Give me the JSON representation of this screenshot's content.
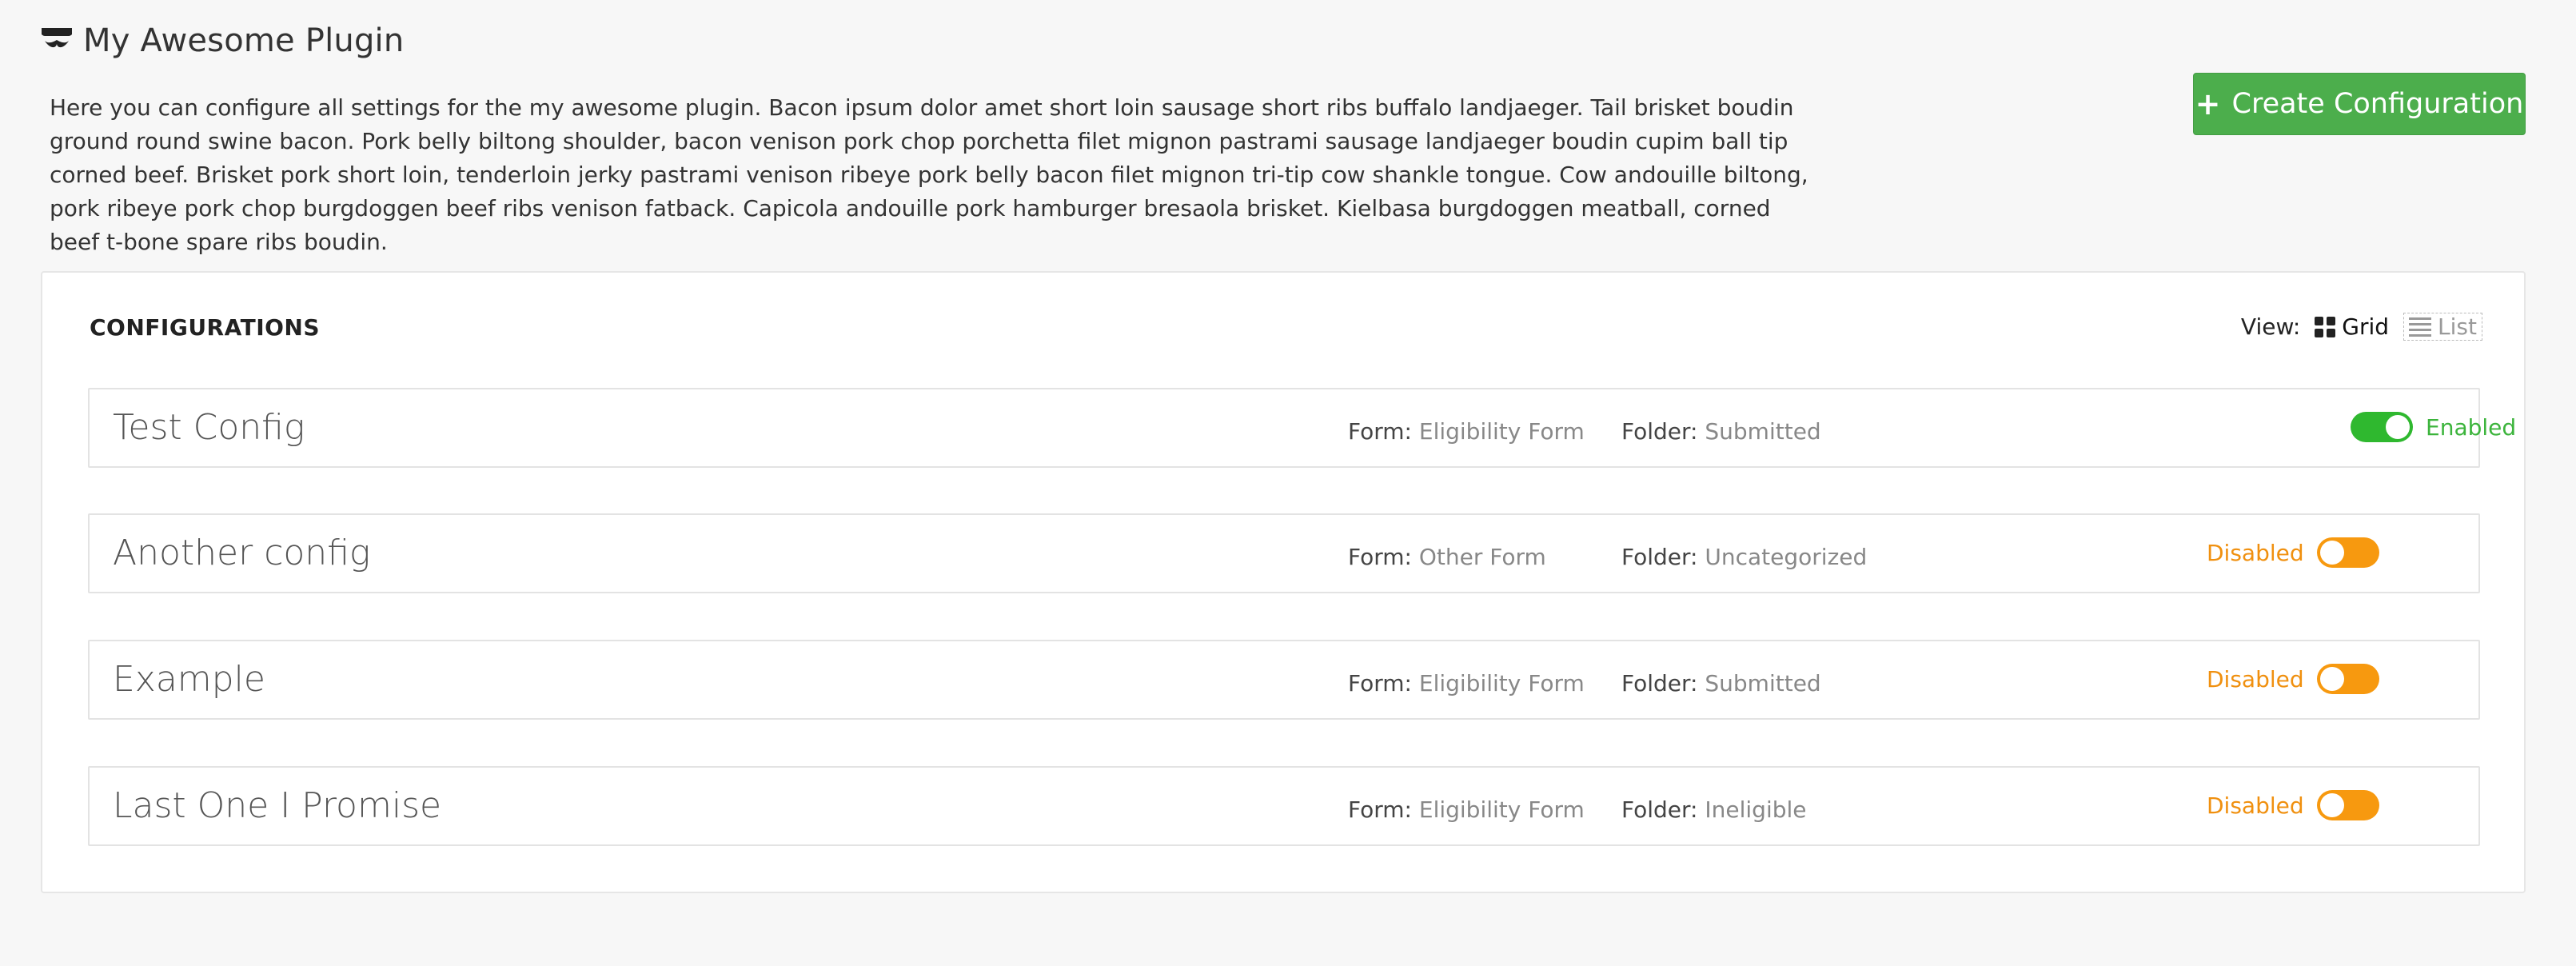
{
  "header": {
    "title": "My Awesome Plugin",
    "logo_icon": "mustache-logo-icon"
  },
  "intro": "Here you can configure all settings for the my awesome plugin. Bacon ipsum dolor amet short loin sausage short ribs buffalo landjaeger. Tail brisket boudin ground round swine bacon. Pork belly biltong shoulder, bacon venison pork chop porchetta filet mignon pastrami sausage landjaeger boudin cupim ball tip corned beef. Brisket pork short loin, tenderloin jerky pastrami venison ribeye pork belly bacon filet mignon tri-tip cow shankle tongue. Cow andouille biltong, pork ribeye pork chop burgdoggen beef ribs venison fatback. Capicola andouille pork hamburger bresaola brisket. Kielbasa burgdoggen meatball, corned beef t-bone spare ribs boudin.",
  "create_button": {
    "label": "Create Configuration",
    "icon": "plus-icon",
    "color": "#4cae4c"
  },
  "panel": {
    "title": "CONFIGURATIONS",
    "view": {
      "label": "View:",
      "grid": "Grid",
      "list": "List",
      "active": "Grid"
    }
  },
  "labels": {
    "form": "Form:",
    "folder": "Folder:"
  },
  "configs": [
    {
      "name": "Test Config",
      "form": "Eligibility Form",
      "folder": "Submitted",
      "status": "Enabled",
      "enabled": true
    },
    {
      "name": "Another config",
      "form": "Other Form",
      "folder": "Uncategorized",
      "status": "Disabled",
      "enabled": false
    },
    {
      "name": "Example",
      "form": "Eligibility Form",
      "folder": "Submitted",
      "status": "Disabled",
      "enabled": false
    },
    {
      "name": "Last One I Promise",
      "form": "Eligibility Form",
      "folder": "Ineligible",
      "status": "Disabled",
      "enabled": false
    }
  ],
  "colors": {
    "enabled": "#2fb82f",
    "disabled": "#f7990f"
  }
}
